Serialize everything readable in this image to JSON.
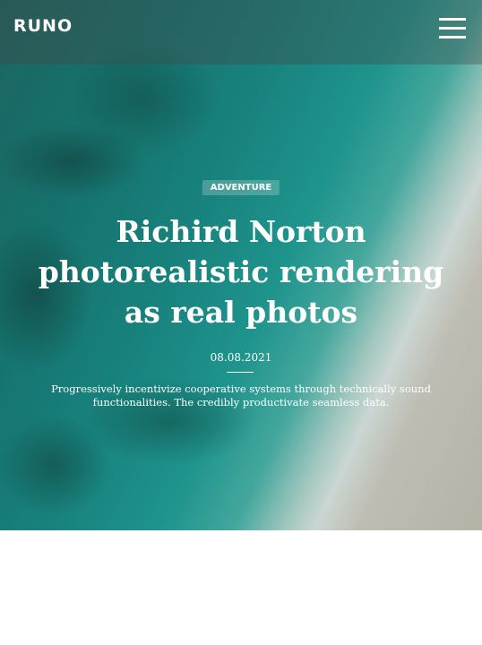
{
  "header": {
    "logo": "RUNO",
    "menu_icon": "hamburger-menu-icon"
  },
  "hero": {
    "category": "ADVENTURE",
    "title": "Richird Norton photorealistic rendering as real photos",
    "date": "08.08.2021",
    "description": "Progressively incentivize cooperative systems through technically sound functionalities. The credibly productivate seamless data."
  },
  "colors": {
    "water_dark": "#1a7d78",
    "water_light": "#23a39b",
    "sand": "#cfc6b8",
    "text": "#ffffff"
  }
}
